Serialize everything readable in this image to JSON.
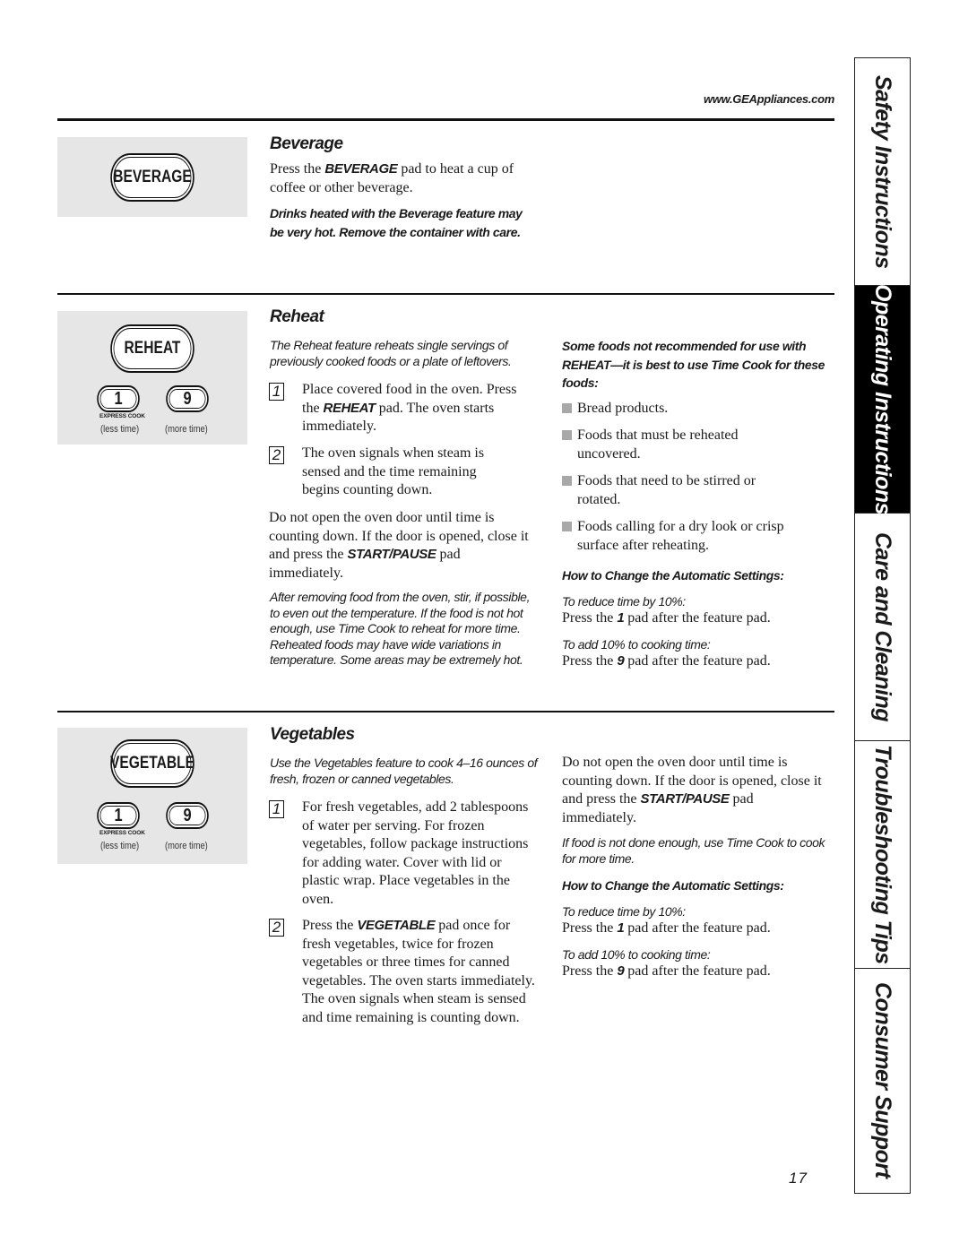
{
  "header": {
    "url": "www.GEAppliances.com"
  },
  "side_tabs": [
    {
      "label": "Safety Instructions",
      "active": false
    },
    {
      "label": "Operating Instructions",
      "active": true
    },
    {
      "label": "Care and Cleaning",
      "active": false
    },
    {
      "label": "Troubleshooting Tips",
      "active": false
    },
    {
      "label": "Consumer Support",
      "active": false
    }
  ],
  "page_number": "17",
  "keypad": {
    "one": "1",
    "nine": "9",
    "express_cook": "EXPRESS COOK",
    "less_time": "(less time)",
    "more_time": "(more time)"
  },
  "beverage": {
    "pad_label": "BEVERAGE",
    "title": "Beverage",
    "p1_pre": "Press the ",
    "p1_kw": "BEVERAGE",
    "p1_post": " pad to heat a cup of coffee or other beverage.",
    "warning": "Drinks heated with the Beverage feature may be very hot. Remove the container with care."
  },
  "reheat": {
    "pad_label": "REHEAT",
    "title": "Reheat",
    "intro": "The Reheat feature reheats single servings of previously cooked foods or a plate of leftovers.",
    "steps": [
      {
        "num": "1",
        "pre": "Place covered food in the oven. Press the ",
        "kw": "REHEAT",
        "post": " pad. The oven starts immediately."
      },
      {
        "num": "2",
        "pre": "The oven signals when steam is sensed and the time remaining begins counting down.",
        "kw": "",
        "post": ""
      }
    ],
    "door_pre": "Do not open the oven door until time is counting down. If the door is opened, close it and press the ",
    "door_kw": "START/PAUSE",
    "door_post": " pad immediately.",
    "after_note": "After removing food from the oven, stir, if possible, to even out the temperature. If the food is not hot enough, use Time Cook to reheat for more time. Reheated foods may have wide variations in temperature. Some areas may be extremely hot.",
    "not_recommended_heading": "Some foods not recommended for use with REHEAT—it is best to use Time Cook for these foods:",
    "not_recommended": [
      "Bread products.",
      "Foods that must be reheated uncovered.",
      "Foods that need to be stirred or rotated.",
      "Foods calling for a dry look or crisp surface after reheating."
    ],
    "settings_heading": "How to Change the Automatic Settings:",
    "reduce_label": "To reduce time by 10%:",
    "reduce_pre": "Press the ",
    "reduce_kw": "1",
    "reduce_post": " pad after the feature pad.",
    "add_label": "To add 10% to cooking time:",
    "add_pre": "Press the ",
    "add_kw": "9",
    "add_post": " pad after the feature pad."
  },
  "vegetables": {
    "pad_label": "VEGETABLE",
    "title": "Vegetables",
    "intro": "Use the Vegetables feature to cook 4–16 ounces of fresh, frozen or canned vegetables.",
    "step1": "For fresh vegetables, add 2 tablespoons of water per serving. For frozen vegetables, follow package instructions for adding water. Cover with lid or plastic wrap. Place vegetables in the oven.",
    "step2_pre": "Press the ",
    "step2_kw": "VEGETABLE",
    "step2_post": " pad once for fresh vegetables, twice for frozen vegetables or three times for canned vegetables. The oven starts immediately. The oven signals when steam is sensed and time remaining is counting down.",
    "step_nums": [
      "1",
      "2"
    ],
    "door_pre": "Do not open the oven door until time is counting down. If the door is opened, close it and press the ",
    "door_kw": "START/PAUSE",
    "door_post": " pad immediately.",
    "done_note": "If food is not done enough, use Time Cook to cook for more time.",
    "settings_heading": "How to Change the Automatic Settings:",
    "reduce_label": "To reduce time by 10%:",
    "reduce_pre": "Press the ",
    "reduce_kw": "1",
    "reduce_post": " pad after the feature pad.",
    "add_label": "To add 10% to cooking time:",
    "add_pre": "Press the ",
    "add_kw": "9",
    "add_post": " pad after the feature pad."
  }
}
